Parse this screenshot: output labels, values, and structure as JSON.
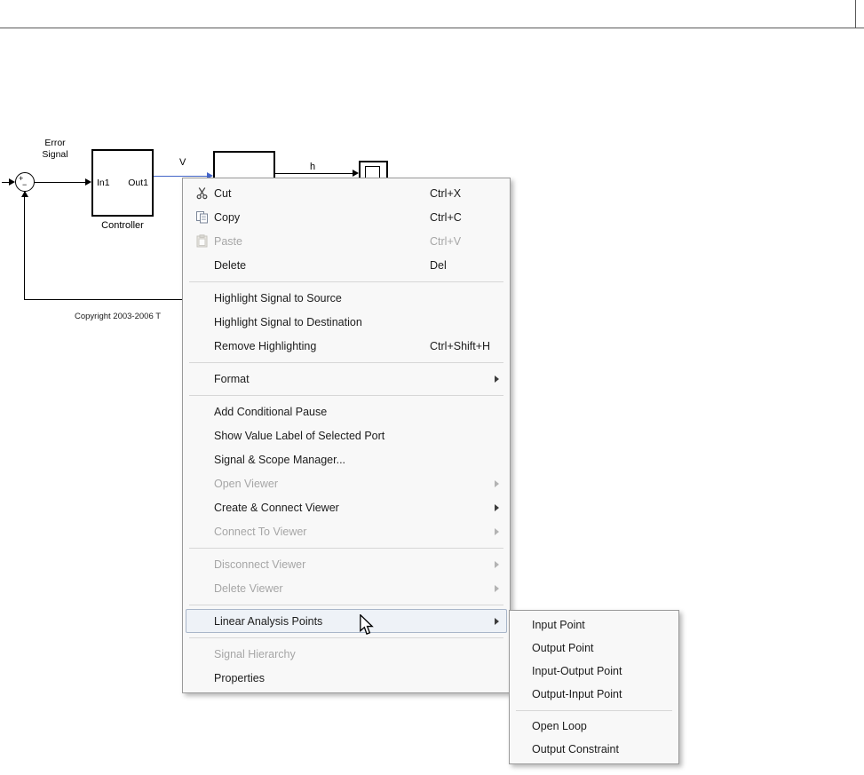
{
  "chrome": {
    "note_top_border": "canvas-top-edge"
  },
  "diagram": {
    "sum_plus": "+",
    "sum_minus": "−",
    "error_label_line1": "Error",
    "error_label_line2": "Signal",
    "controller_in": "In1",
    "controller_out": "Out1",
    "controller_label": "Controller",
    "signal_v": "V",
    "signal_h": "h",
    "copyright": "Copyright 2003-2006 T"
  },
  "context_menu": {
    "items": [
      {
        "type": "item",
        "label": "Cut",
        "shortcut": "Ctrl+X",
        "icon": "scissors-icon",
        "enabled": true
      },
      {
        "type": "item",
        "label": "Copy",
        "shortcut": "Ctrl+C",
        "icon": "copy-icon",
        "enabled": true
      },
      {
        "type": "item",
        "label": "Paste",
        "shortcut": "Ctrl+V",
        "icon": "paste-icon",
        "enabled": false
      },
      {
        "type": "item",
        "label": "Delete",
        "shortcut": "Del",
        "enabled": true
      },
      {
        "type": "separator"
      },
      {
        "type": "item",
        "label": "Highlight Signal to Source",
        "enabled": true
      },
      {
        "type": "item",
        "label": "Highlight Signal to Destination",
        "enabled": true
      },
      {
        "type": "item",
        "label": "Remove Highlighting",
        "shortcut": "Ctrl+Shift+H",
        "enabled": true
      },
      {
        "type": "separator"
      },
      {
        "type": "item",
        "label": "Format",
        "submenu": true,
        "enabled": true
      },
      {
        "type": "separator"
      },
      {
        "type": "item",
        "label": "Add Conditional Pause",
        "enabled": true
      },
      {
        "type": "item",
        "label": "Show Value Label of Selected Port",
        "enabled": true
      },
      {
        "type": "item",
        "label": "Signal & Scope Manager...",
        "enabled": true
      },
      {
        "type": "item",
        "label": "Open Viewer",
        "submenu": true,
        "enabled": false
      },
      {
        "type": "item",
        "label": "Create & Connect Viewer",
        "submenu": true,
        "enabled": true
      },
      {
        "type": "item",
        "label": "Connect To Viewer",
        "submenu": true,
        "enabled": false
      },
      {
        "type": "separator"
      },
      {
        "type": "item",
        "label": "Disconnect Viewer",
        "submenu": true,
        "enabled": false
      },
      {
        "type": "item",
        "label": "Delete Viewer",
        "submenu": true,
        "enabled": false
      },
      {
        "type": "separator"
      },
      {
        "type": "item",
        "label": "Linear Analysis Points",
        "submenu": true,
        "enabled": true,
        "highlighted": true
      },
      {
        "type": "separator"
      },
      {
        "type": "item",
        "label": "Signal Hierarchy",
        "enabled": false
      },
      {
        "type": "item",
        "label": "Properties",
        "enabled": true
      }
    ]
  },
  "submenu": {
    "items": [
      {
        "type": "item",
        "label": "Input Point",
        "enabled": true
      },
      {
        "type": "item",
        "label": "Output Point",
        "enabled": true
      },
      {
        "type": "item",
        "label": "Input-Output Point",
        "enabled": true
      },
      {
        "type": "item",
        "label": "Output-Input Point",
        "enabled": true
      },
      {
        "type": "separator"
      },
      {
        "type": "item",
        "label": "Open Loop",
        "enabled": true
      },
      {
        "type": "item",
        "label": "Output Constraint",
        "enabled": true
      }
    ]
  },
  "colors": {
    "signal_selected": "#4465c8",
    "menu_highlight_fill": "#eef2f7",
    "menu_highlight_border": "#a9b6c9",
    "disabled_text": "#a6a6a6"
  }
}
